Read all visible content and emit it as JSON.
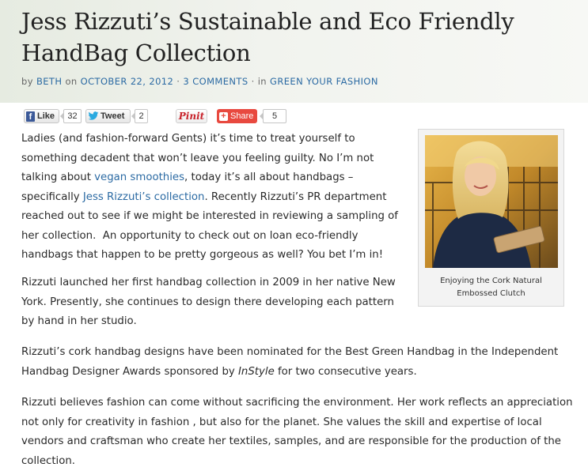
{
  "post": {
    "title": "Jess Rizzuti’s Sustainable and Eco Friendly HandBag Collection",
    "byline": {
      "by_text": "by",
      "author": "BETH",
      "on_text": "on",
      "date": "OCTOBER 22, 2012",
      "sep1": "·",
      "comments": "3 COMMENTS",
      "sep2": "· in",
      "category": "GREEN YOUR FASHION"
    }
  },
  "share": {
    "facebook_label": "Like",
    "facebook_count": "32",
    "twitter_label": "Tweet",
    "twitter_count": "2",
    "pinterest_label": "Pinit",
    "share_label": "Share",
    "share_count": "5",
    "icons": {
      "facebook": "facebook-icon",
      "twitter": "twitter-bird-icon",
      "share": "plus-icon"
    }
  },
  "body": {
    "p1": {
      "t1": "Ladies (and fashion-forward Gents) it’s time to treat yourself to something decadent that won’t leave you feeling guilty. No I’m not talking about ",
      "link1": "vegan smoothies",
      "t2": ", today it’s all about handbags – specifically ",
      "link2": "Jess Rizzuti’s collection",
      "t3": ". Recently Rizzuti’s PR department reached out to see if we might be interested in reviewing a sampling of her collection.  An opportunity to check out on loan eco-friendly handbags that happen to be pretty gorgeous as well? You bet I’m in!"
    },
    "p2": "Rizzuti launched her first handbag collection in 2009 in her native New York. Presently, she continues to design there developing each pattern by hand in her studio.",
    "p3": {
      "t1": "Rizzuti’s cork handbag designs have been nominated for the Best Green Handbag in the Independent Handbag Designer Awards sponsored by ",
      "em": "InStyle",
      "t2": " for two consecutive years."
    },
    "p4": "Rizzuti believes fashion can come without sacrificing the environment. Her work reflects an appreciation not only for creativity in fashion , but also for the planet. She values the skill and expertise of local vendors and craftsman who create her textiles, samples, and are responsible for the production of the collection."
  },
  "figure": {
    "caption": "Enjoying the Cork Natural Embossed Clutch"
  },
  "colors": {
    "link": "#2b6aa3",
    "header_bg": "#eef1ea",
    "facebook": "#3b5998",
    "share_button": "#e8493f",
    "pinterest": "#c8232c"
  }
}
